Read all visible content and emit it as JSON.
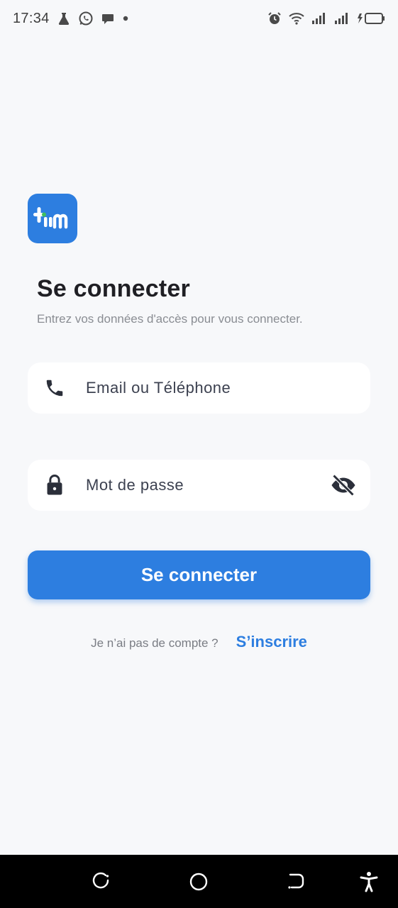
{
  "status_bar": {
    "time": "17:34",
    "left_icons": [
      "flask-icon",
      "whatsapp-icon",
      "chat-bubble-icon",
      "dot-icon"
    ],
    "right_icons": [
      "alarm-icon",
      "wifi-icon",
      "signal-icon",
      "signal-icon",
      "charging-icon",
      "battery-icon"
    ]
  },
  "app": {
    "logo_text": "tiim",
    "brand_color": "#2d7ee0"
  },
  "login": {
    "title": "Se connecter",
    "subtitle": "Entrez vos données d'accès pour vous connecter.",
    "email_field": {
      "placeholder": "Email ou Téléphone",
      "value": "",
      "icon": "phone-icon"
    },
    "password_field": {
      "placeholder": "Mot de passe",
      "value": "",
      "icon": "lock-icon",
      "toggle_icon": "eye-off-icon"
    },
    "submit_label": "Se connecter",
    "signup_prompt": "Je n’ai pas de compte ?",
    "signup_link": "S’inscrire"
  },
  "nav_bar": {
    "buttons": [
      "recent-apps-icon",
      "home-icon",
      "back-icon",
      "accessibility-icon"
    ]
  }
}
